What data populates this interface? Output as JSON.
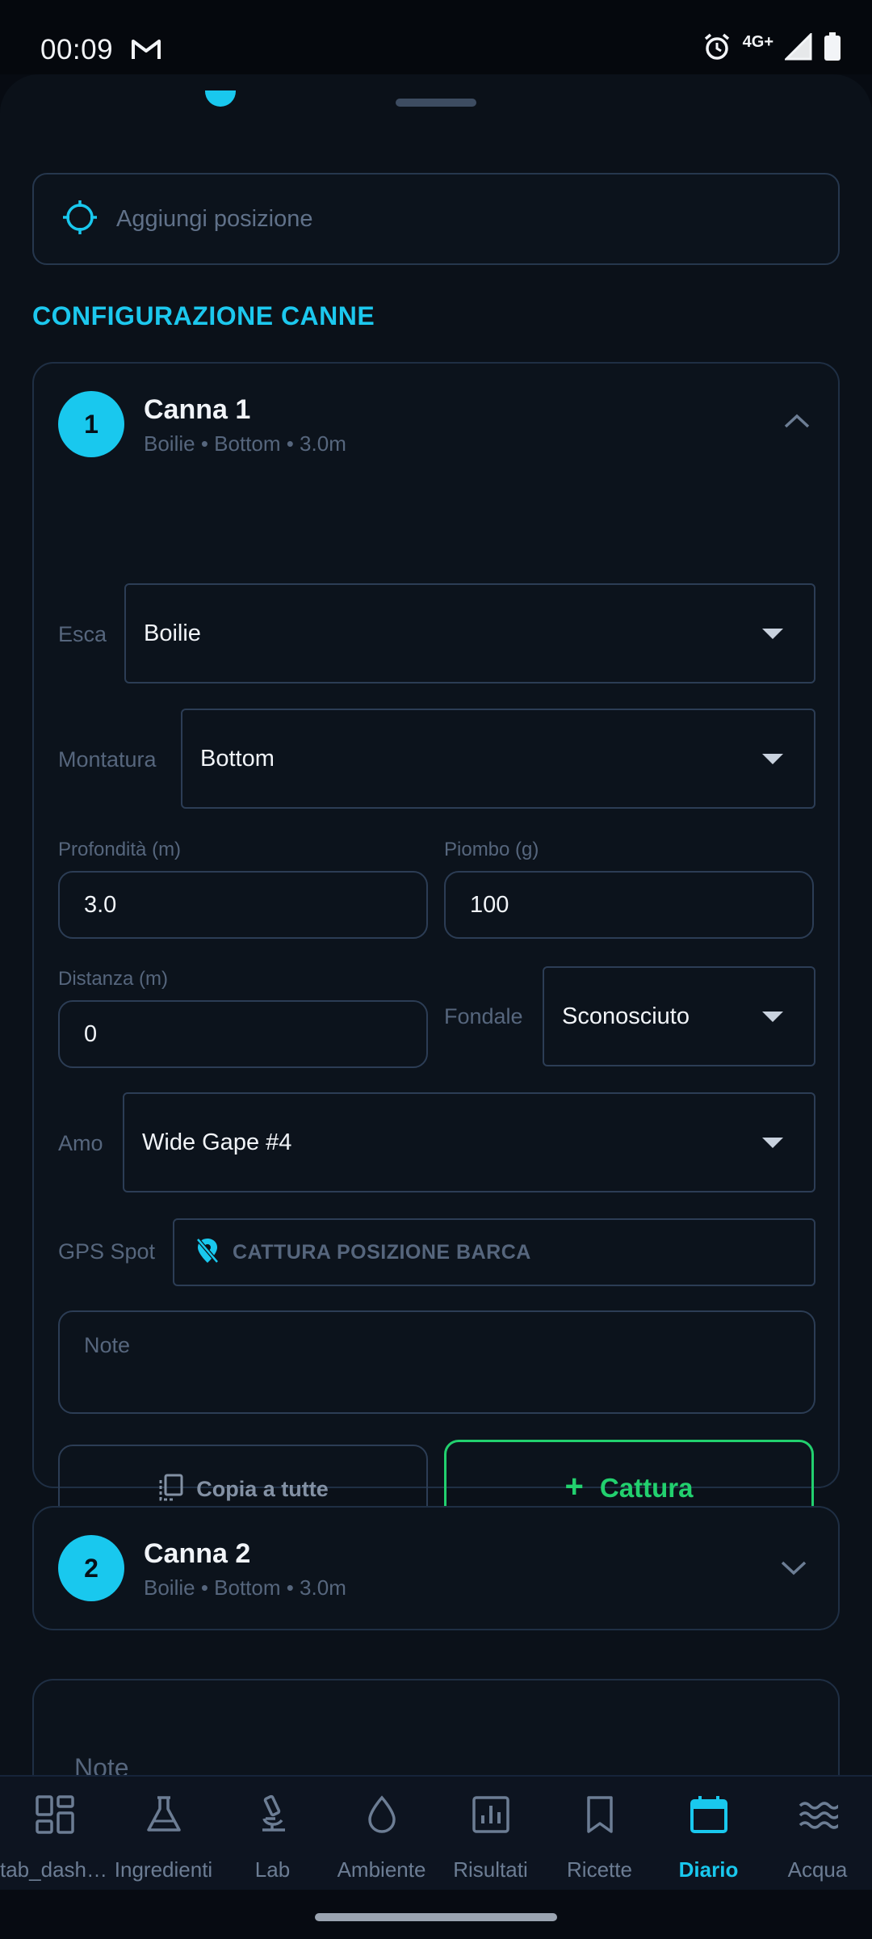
{
  "status_bar": {
    "time": "00:09",
    "network": "4G+",
    "icons": [
      "gmail-icon",
      "alarm-icon",
      "signal-icon",
      "battery-icon"
    ]
  },
  "location": {
    "placeholder": "Aggiungi posizione",
    "icon": "crosshair-icon"
  },
  "section": {
    "title": "CONFIGURAZIONE CANNE"
  },
  "rods": [
    {
      "number": "1",
      "title": "Canna 1",
      "subtitle": "Boilie • Bottom • 3.0m",
      "expanded": true,
      "fields": {
        "bait_label": "Esca",
        "bait_value": "Boilie",
        "rig_label": "Montatura",
        "rig_value": "Bottom",
        "depth_label": "Profondità (m)",
        "depth_value": "3.0",
        "lead_label": "Piombo (g)",
        "lead_value": "100",
        "distance_label": "Distanza (m)",
        "distance_value": "0",
        "bottom_label": "Fondale",
        "bottom_value": "Sconosciuto",
        "hook_label": "Amo",
        "hook_value": "Wide Gape #4",
        "gps_label": "GPS Spot",
        "gps_button": "CATTURA POSIZIONE BARCA",
        "note_placeholder": "Note"
      },
      "actions": {
        "copy_label": "Copia a tutte",
        "catch_plus": "+",
        "catch_label": "Cattura"
      }
    },
    {
      "number": "2",
      "title": "Canna 2",
      "subtitle": "Boilie • Bottom • 3.0m",
      "expanded": false
    }
  ],
  "notes_card": {
    "title": "Note"
  },
  "bottom_nav": [
    {
      "label": "tab_dashboard",
      "icon": "dashboard-grid-icon",
      "active": false
    },
    {
      "label": "Ingredienti",
      "icon": "flask-icon",
      "active": false
    },
    {
      "label": "Lab",
      "icon": "microscope-icon",
      "active": false
    },
    {
      "label": "Ambiente",
      "icon": "water-drop-icon",
      "active": false
    },
    {
      "label": "Risultati",
      "icon": "bar-chart-icon",
      "active": false
    },
    {
      "label": "Ricette",
      "icon": "bookmark-icon",
      "active": false
    },
    {
      "label": "Diario",
      "icon": "calendar-icon",
      "active": true
    },
    {
      "label": "Acqua",
      "icon": "waves-icon",
      "active": false
    }
  ],
  "colors": {
    "accent": "#19c8ee",
    "success": "#22d06e",
    "background": "#0b1119",
    "border": "#26374d"
  }
}
